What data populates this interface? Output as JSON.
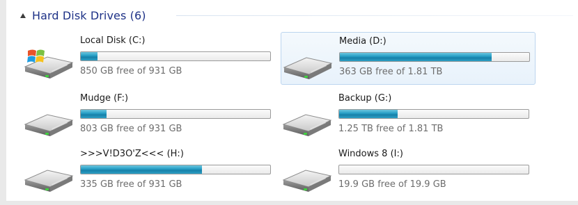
{
  "group": {
    "title": "Hard Disk Drives (6)"
  },
  "drives": [
    {
      "name": "Local Disk (C:)",
      "free_text": "850 GB free of 931 GB",
      "used_fraction": 0.087,
      "icon": "windows-system-drive-icon",
      "selected": false
    },
    {
      "name": "Media (D:)",
      "free_text": "363 GB free of 1.81 TB",
      "used_fraction": 0.8,
      "icon": "hard-drive-icon",
      "selected": true
    },
    {
      "name": "Mudge (F:)",
      "free_text": "803 GB free of 931 GB",
      "used_fraction": 0.137,
      "icon": "hard-drive-icon",
      "selected": false
    },
    {
      "name": "Backup  (G:)",
      "free_text": "1.25 TB free of 1.81 TB",
      "used_fraction": 0.31,
      "icon": "hard-drive-icon",
      "selected": false
    },
    {
      "name": ">>>V!D3O'Z<<< (H:)",
      "free_text": "335 GB free of 931 GB",
      "used_fraction": 0.64,
      "icon": "hard-drive-icon",
      "selected": false
    },
    {
      "name": "Windows 8 (I:)",
      "free_text": "19.9 GB free of 19.9 GB",
      "used_fraction": 0.0,
      "icon": "hard-drive-icon",
      "selected": false
    }
  ],
  "colors": {
    "header_text": "#1e3287",
    "bar_fill": "#1f8fb9",
    "selection_border": "#bcd5ef"
  }
}
